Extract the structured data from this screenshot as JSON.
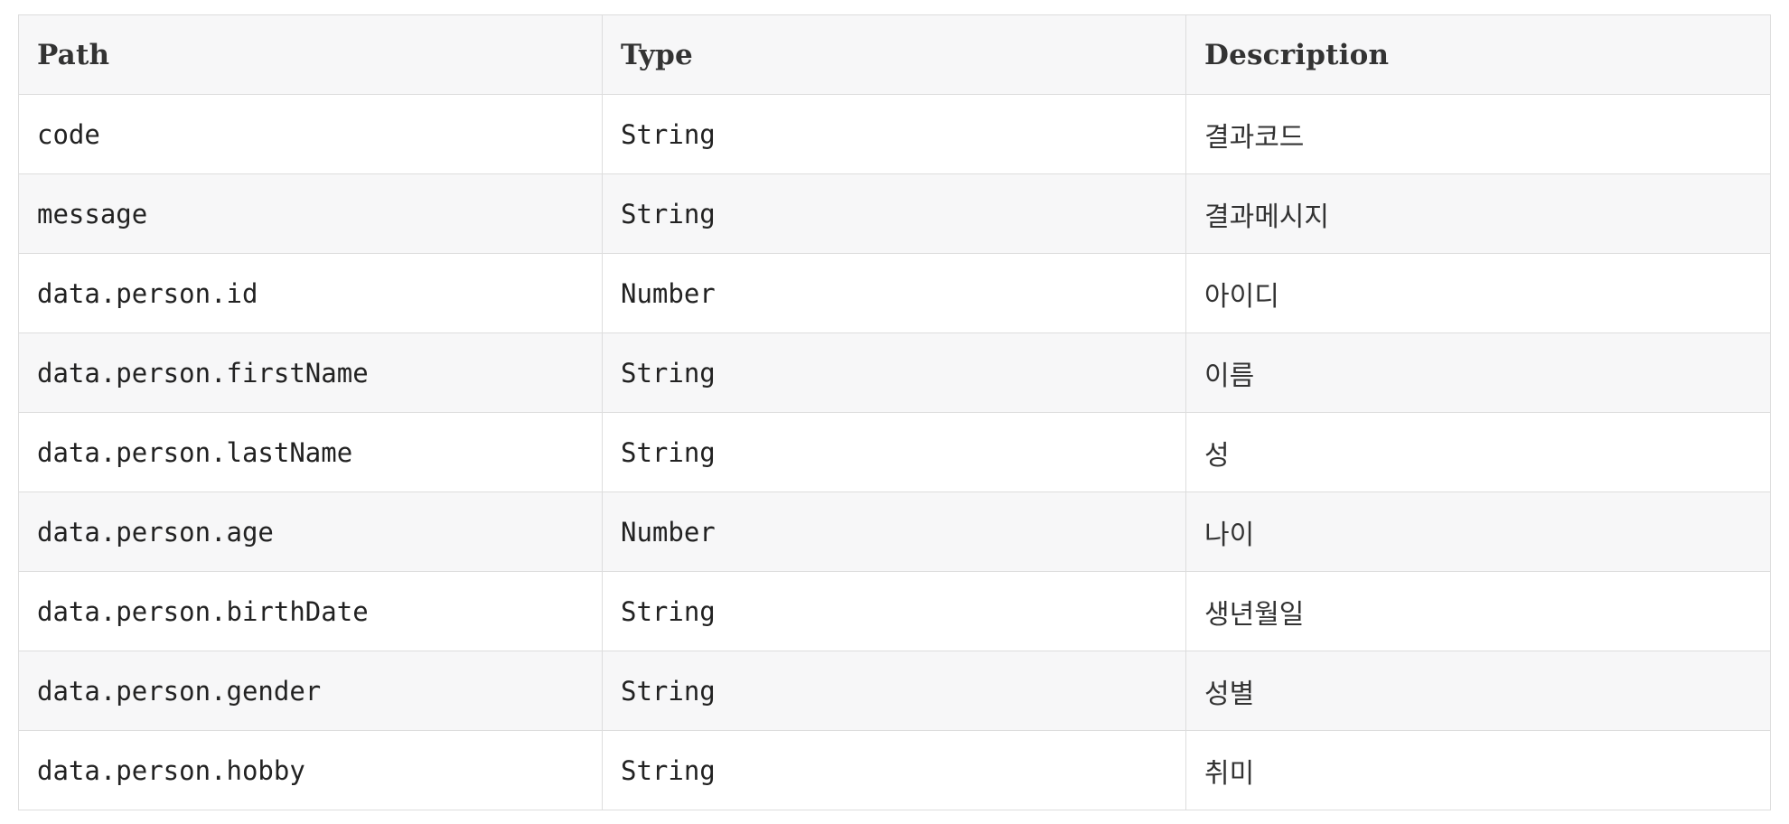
{
  "table": {
    "headers": [
      "Path",
      "Type",
      "Description"
    ],
    "rows": [
      [
        "code",
        "String",
        "결과코드"
      ],
      [
        "message",
        "String",
        "결과메시지"
      ],
      [
        "data.person.id",
        "Number",
        "아이디"
      ],
      [
        "data.person.firstName",
        "String",
        "이름"
      ],
      [
        "data.person.lastName",
        "String",
        "성"
      ],
      [
        "data.person.age",
        "Number",
        "나이"
      ],
      [
        "data.person.birthDate",
        "String",
        "생년월일"
      ],
      [
        "data.person.gender",
        "String",
        "성별"
      ],
      [
        "data.person.hobby",
        "String",
        "취미"
      ]
    ]
  }
}
